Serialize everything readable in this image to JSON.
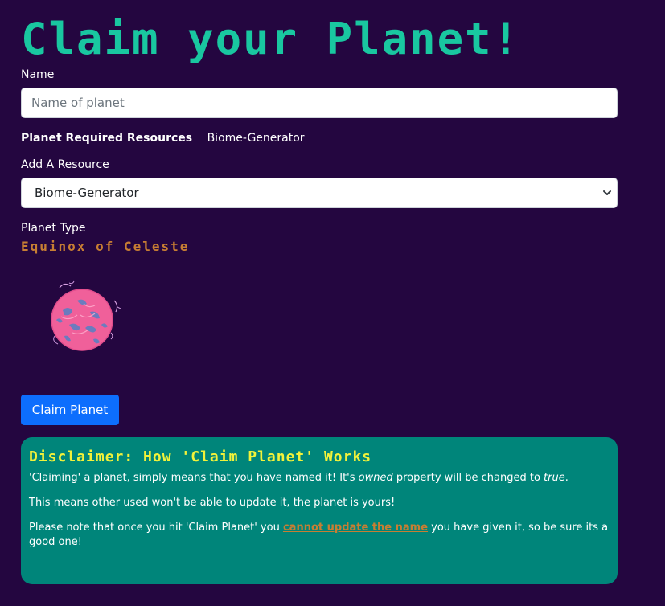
{
  "page": {
    "title": "Claim your Planet!"
  },
  "form": {
    "name_label": "Name",
    "name_placeholder": "Name of planet",
    "name_value": "",
    "required_resources_label": "Planet Required Resources",
    "required_resources_value": "Biome-Generator",
    "add_resource_label": "Add A Resource",
    "add_resource_selected": "Biome-Generator",
    "planet_type_label": "Planet Type",
    "planet_type_name": "Equinox of Celeste",
    "claim_button_label": "Claim Planet"
  },
  "disclaimer": {
    "title": "Disclaimer: How 'Claim Planet' Works",
    "p1_before": "'Claiming' a planet, simply means that you have named it! It's ",
    "p1_em1": "owned",
    "p1_middle": " property will be changed to ",
    "p1_em2": "true",
    "p1_after": ".",
    "p2": "This means other used won't be able to update it, the planet is yours!",
    "p3_before": "Please note that once you hit 'Claim Planet' you ",
    "p3_link": "cannot update the name",
    "p3_after": " you have given it, so be sure its a good one!"
  },
  "icons": {
    "select_chevron": "chevron-down-icon",
    "planet": "planet-image"
  },
  "colors": {
    "background": "#240640",
    "title": "#19c7a0",
    "planet_type": "#c77e33",
    "button": "#0d6efd",
    "disclaimer_bg": "#00857a",
    "disclaimer_title": "#f2f23a",
    "link": "#c77e33",
    "planet_pink": "#f0609a",
    "planet_blue": "#5d7fc2"
  }
}
